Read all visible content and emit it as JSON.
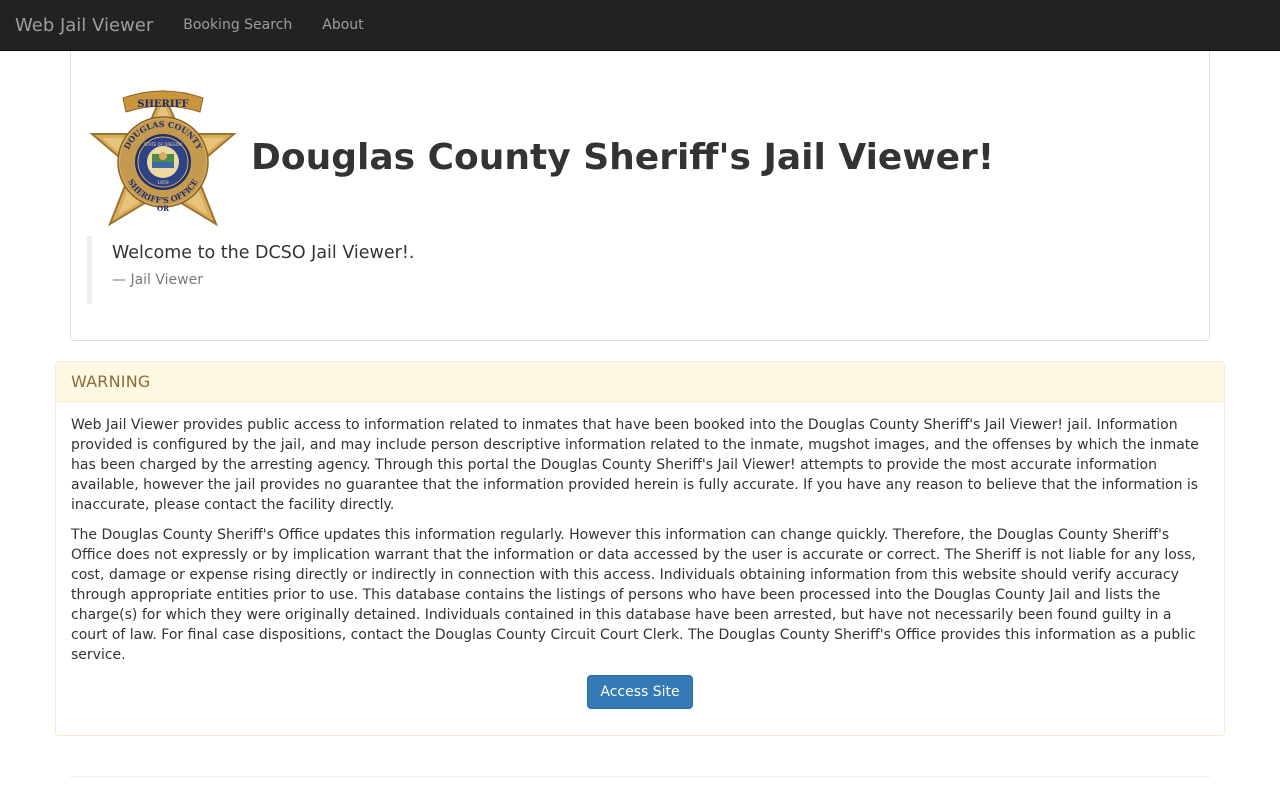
{
  "navbar": {
    "brand": "Web Jail Viewer",
    "links": [
      {
        "label": "Booking Search"
      },
      {
        "label": "About"
      }
    ]
  },
  "header": {
    "title": "Douglas County Sheriff's Jail Viewer!",
    "badge": {
      "top_ribbon": "SHERIFF",
      "ring_top": "DOUGLAS COUNTY",
      "ring_bottom": "SHERIFF'S OFFICE",
      "seal_text": "STATE OF OREGON",
      "seal_year": "1859",
      "bottom_point": "OR"
    },
    "quote": {
      "text": "Welcome to the DCSO Jail Viewer!.",
      "footer": "— Jail Viewer"
    }
  },
  "warning_panel": {
    "title": "WARNING",
    "paragraphs": [
      "Web Jail Viewer provides public access to information related to inmates that have been booked into the Douglas County Sheriff's Jail Viewer! jail. Information provided is configured by the jail, and may include person descriptive information related to the inmate, mugshot images, and the offenses by which the inmate has been charged by the arresting agency. Through this portal the Douglas County Sheriff's Jail Viewer! attempts to provide the most accurate information available, however the jail provides no guarantee that the information provided herein is fully accurate. If you have any reason to believe that the information is inaccurate, please contact the facility directly.",
      "The Douglas County Sheriff's Office updates this information regularly. However this information can change quickly. Therefore, the Douglas County Sheriff's Office does not expressly or by implication warrant that the information or data accessed by the user is accurate or correct. The Sheriff is not liable for any loss, cost, damage or expense rising directly or indirectly in connection with this access. Individuals obtaining information from this website should verify accuracy through appropriate entities prior to use. This database contains the listings of persons who have been processed into the Douglas County Jail and lists the charge(s) for which they were originally detained. Individuals contained in this database have been arrested, but have not necessarily been found guilty in a court of law. For final case dispositions, contact the Douglas County Circuit Court Clerk. The Douglas County Sheriff's Office provides this information as a public service."
    ],
    "button_label": "Access Site"
  },
  "colors": {
    "navbar_bg": "#222222",
    "warning_bg": "#fcf8e3",
    "warning_text": "#8a6d3b",
    "primary": "#337ab7",
    "badge_gold": "#d9ad5c",
    "badge_navy": "#1f2f6b"
  }
}
